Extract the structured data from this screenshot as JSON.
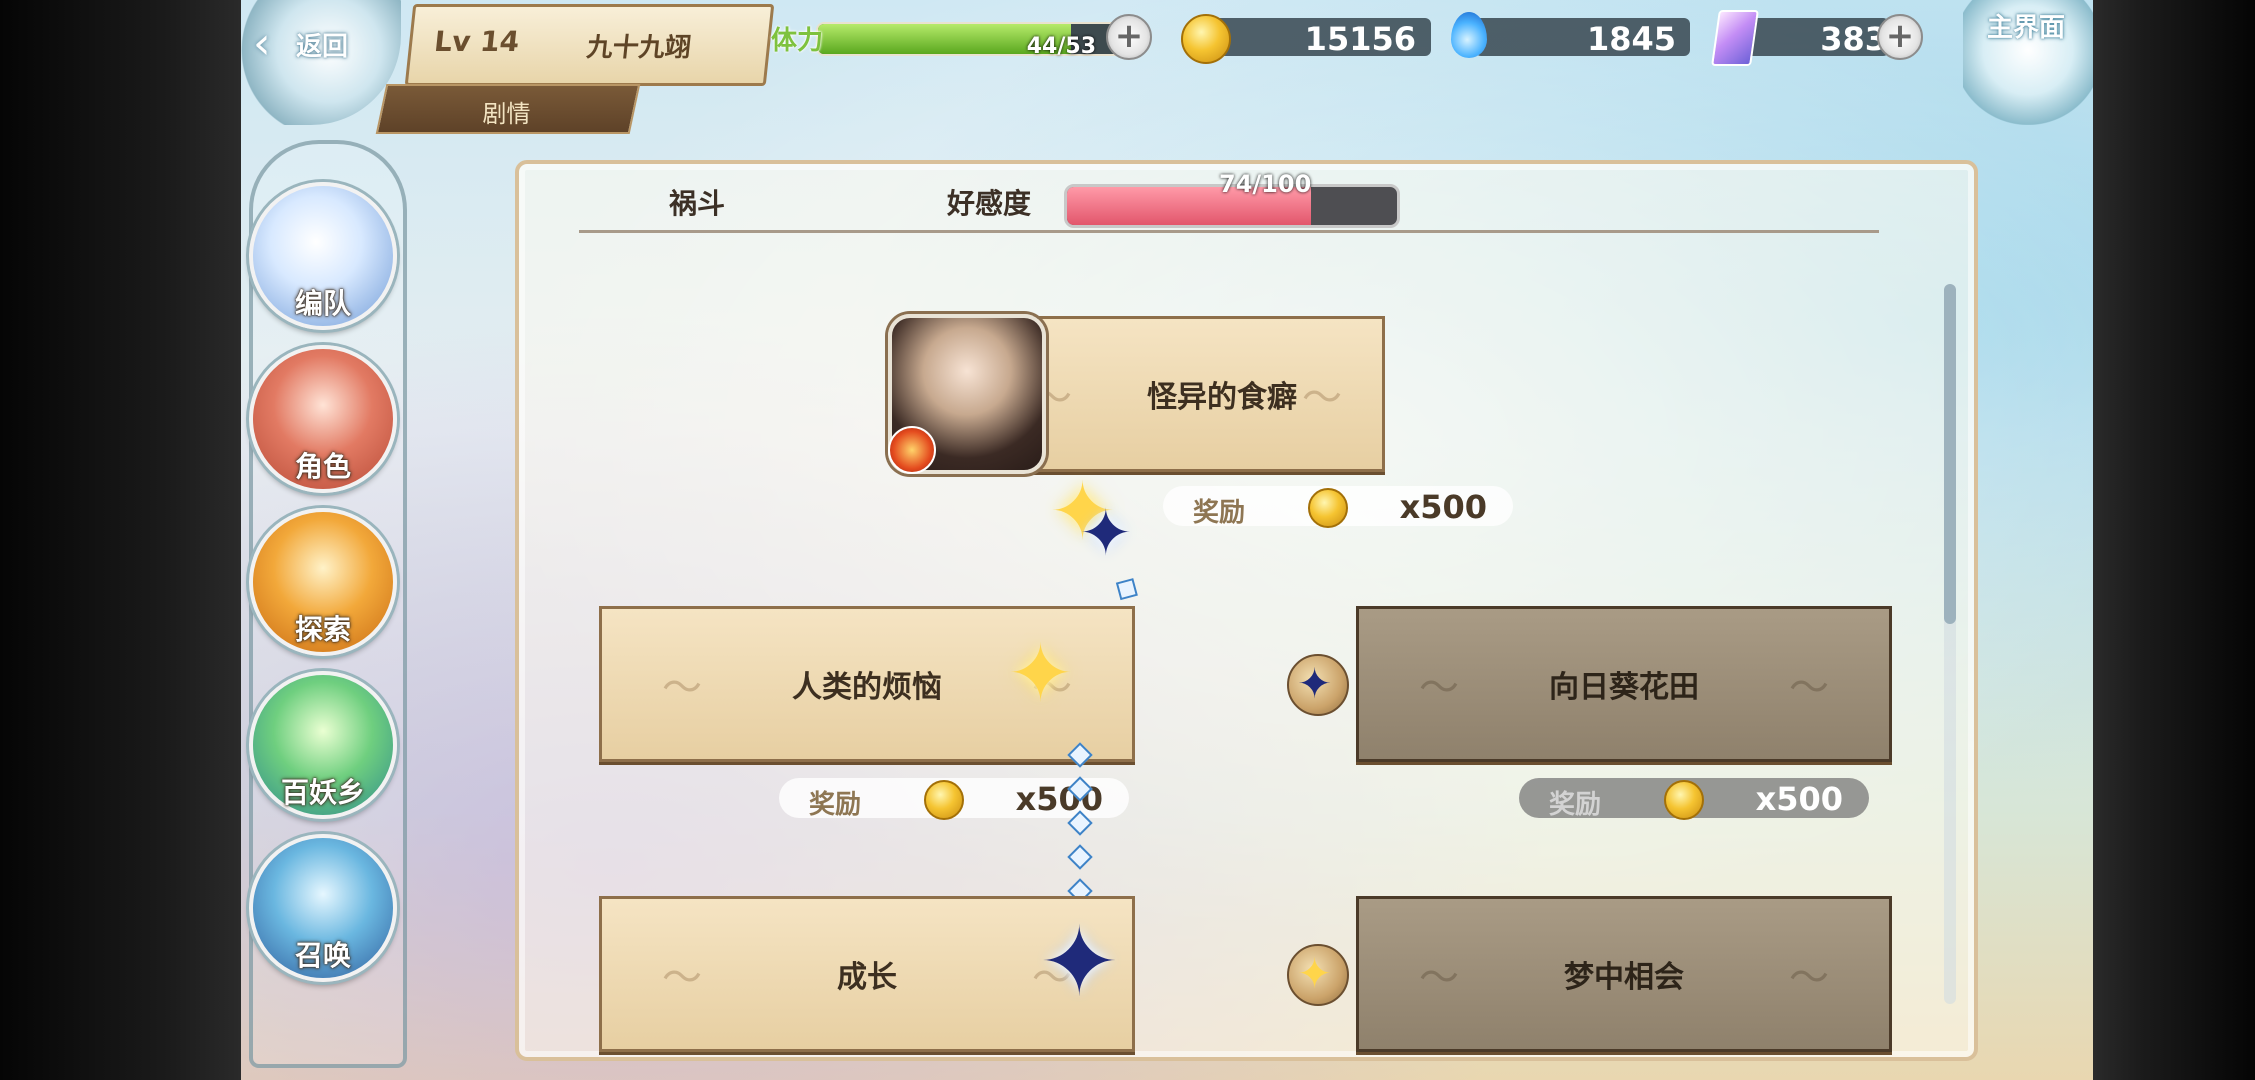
{
  "topbar": {
    "back_label": "返回",
    "level_label": "Lv 14",
    "player_name": "九十九翊",
    "mode_label": "剧情",
    "stamina_label": "体力",
    "stamina_value": "44/53",
    "stamina_fraction": 0.83,
    "gold": "15156",
    "water": "1845",
    "gems": "383",
    "home_label": "主界面"
  },
  "nav": {
    "items": [
      {
        "label": "编队",
        "icon": "team-icon"
      },
      {
        "label": "角色",
        "icon": "character-icon"
      },
      {
        "label": "探索",
        "icon": "explore-icon"
      },
      {
        "label": "百妖乡",
        "icon": "village-icon"
      },
      {
        "label": "召唤",
        "icon": "summon-icon"
      }
    ]
  },
  "panel": {
    "character_name": "祸斗",
    "affinity_label": "好感度",
    "affinity_value": "74/100",
    "affinity_fraction": 0.74
  },
  "stories": [
    {
      "title": "怪异的食癖",
      "reward_label": "奖励",
      "reward_amount": "x500",
      "locked": false
    },
    {
      "title": "人类的烦恼",
      "reward_label": "奖励",
      "reward_amount": "x500",
      "locked": false
    },
    {
      "title": "向日葵花田",
      "reward_label": "奖励",
      "reward_amount": "x500",
      "locked": true
    },
    {
      "title": "成长",
      "locked": false
    },
    {
      "title": "梦中相会",
      "locked": true
    }
  ],
  "colors": {
    "stamina_fill": "#5aa81f",
    "affinity_fill": "#e2566c",
    "card_bg": "#f5e4c3",
    "card_locked_bg": "#8f816c"
  }
}
